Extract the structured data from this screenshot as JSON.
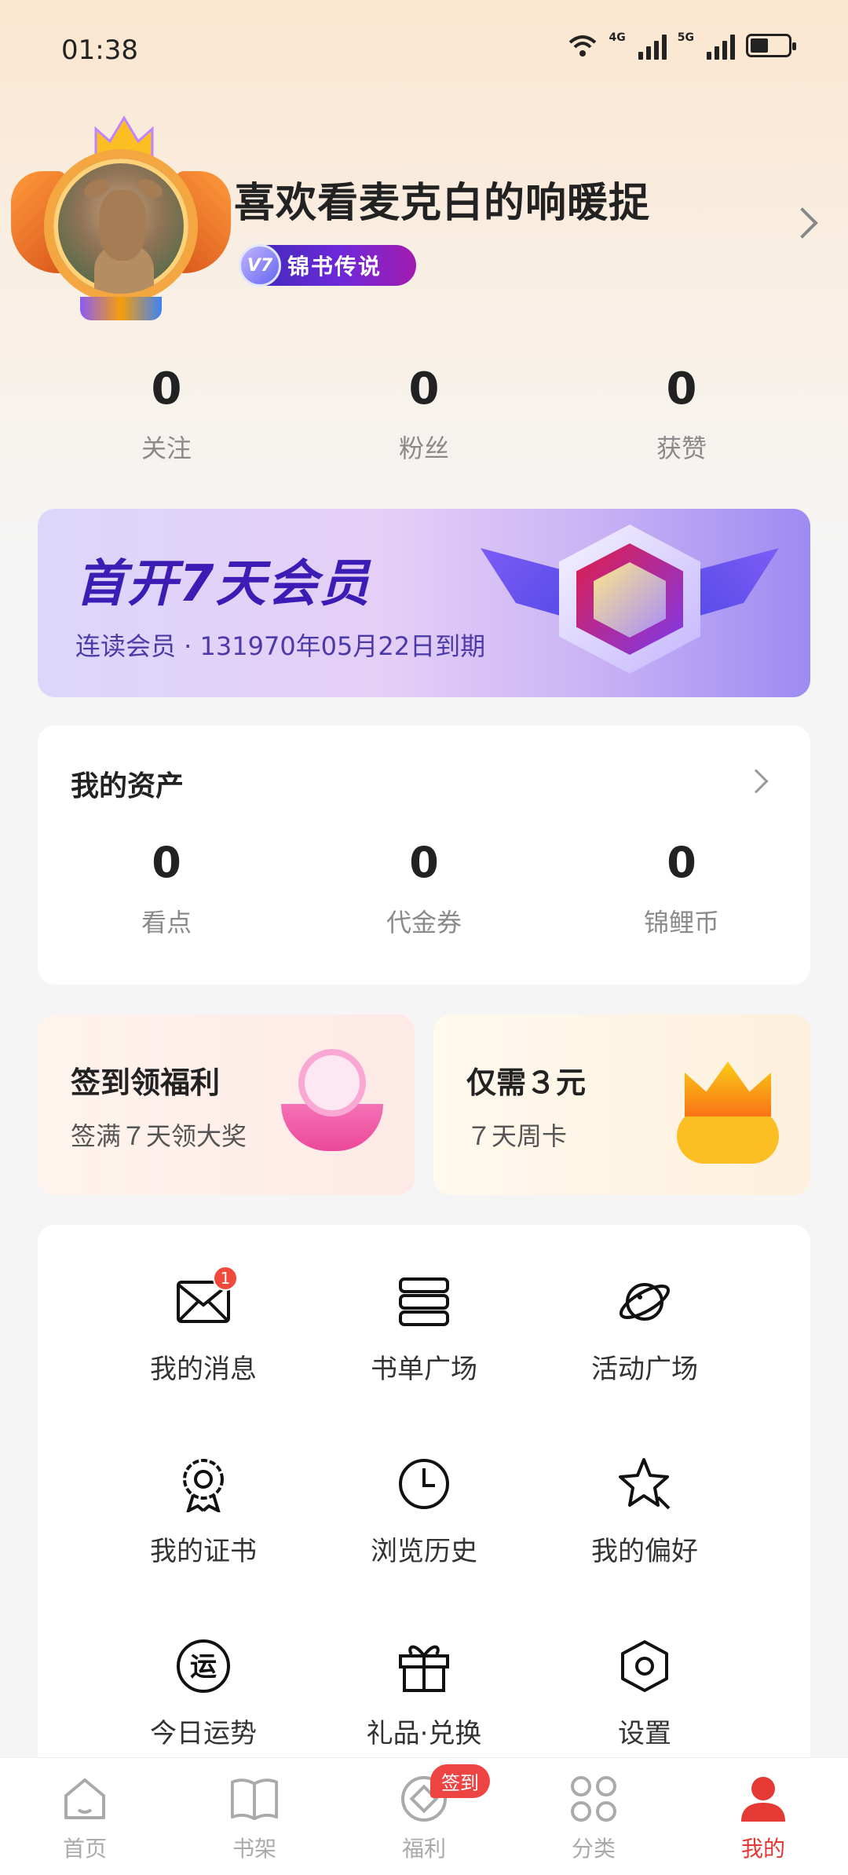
{
  "status_bar": {
    "time": "01:38",
    "net1": "4G",
    "net2": "5G"
  },
  "profile": {
    "username": "喜欢看麦克白的响暖捉",
    "vip_level": "V7",
    "vip_title": "锦书传说"
  },
  "stats": [
    {
      "value": "0",
      "label": "关注"
    },
    {
      "value": "0",
      "label": "粉丝"
    },
    {
      "value": "0",
      "label": "获赞"
    }
  ],
  "vip_banner": {
    "title": "首开7天会员",
    "subtitle": "连读会员 · 131970年05月22日到期"
  },
  "assets": {
    "title": "我的资产",
    "items": [
      {
        "value": "0",
        "label": "看点"
      },
      {
        "value": "0",
        "label": "代金券"
      },
      {
        "value": "0",
        "label": "锦鲤币"
      }
    ]
  },
  "promos": [
    {
      "title": "签到领福利",
      "subtitle": "签满７天领大奖"
    },
    {
      "title": "仅需３元",
      "subtitle": "７天周卡"
    }
  ],
  "grid": [
    {
      "label": "我的消息",
      "icon": "mail-icon",
      "badge": "1"
    },
    {
      "label": "书单广场",
      "icon": "book-stack-icon"
    },
    {
      "label": "活动广场",
      "icon": "planet-icon"
    },
    {
      "label": "我的证书",
      "icon": "certificate-icon"
    },
    {
      "label": "浏览历史",
      "icon": "clock-icon"
    },
    {
      "label": "我的偏好",
      "icon": "star-icon"
    },
    {
      "label": "今日运势",
      "icon": "fortune-icon",
      "glyph": "运"
    },
    {
      "label": "礼品·兑换",
      "icon": "gift-icon"
    },
    {
      "label": "设置",
      "icon": "settings-icon"
    }
  ],
  "tabs": [
    {
      "label": "首页",
      "icon": "home-icon"
    },
    {
      "label": "书架",
      "icon": "bookshelf-icon"
    },
    {
      "label": "福利",
      "icon": "welfare-icon",
      "badge": "签到"
    },
    {
      "label": "分类",
      "icon": "category-icon"
    },
    {
      "label": "我的",
      "icon": "profile-icon",
      "active": true
    }
  ],
  "colors": {
    "accent": "#e53935",
    "vip_purple": "#3b1cb5",
    "badge_red": "#f04a3c"
  }
}
